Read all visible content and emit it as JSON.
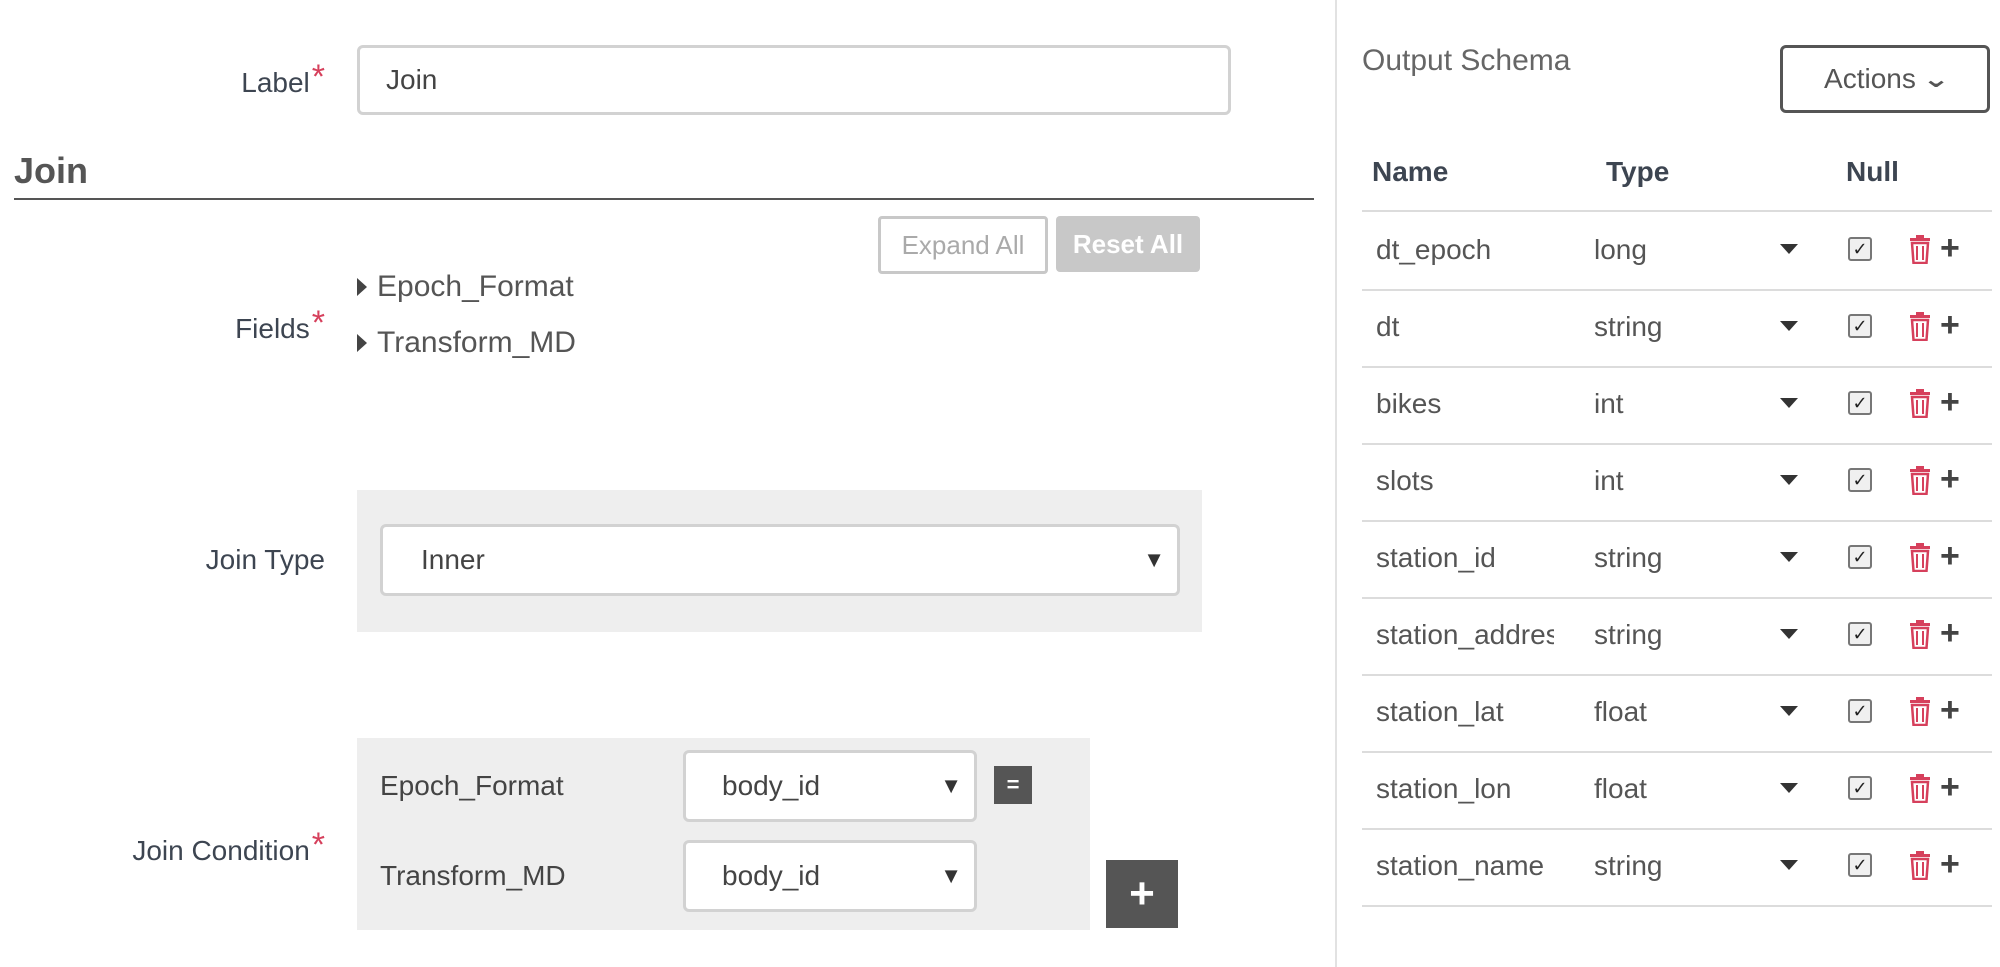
{
  "form": {
    "label_field": {
      "label": "Label",
      "required_mark": "*",
      "value": "Join"
    },
    "section_title": "Join",
    "fields": {
      "label": "Fields",
      "required_mark": "*",
      "expand_all": "Expand All",
      "reset_all": "Reset All",
      "items": [
        "Epoch_Format",
        "Transform_MD"
      ]
    },
    "join_type": {
      "label": "Join Type",
      "value": "Inner"
    },
    "join_condition": {
      "label": "Join Condition",
      "required_mark": "*",
      "rows": [
        {
          "source": "Epoch_Format",
          "field": "body_id"
        },
        {
          "source": "Transform_MD",
          "field": "body_id"
        }
      ],
      "equals_symbol": "=",
      "add_symbol": "+"
    }
  },
  "schema": {
    "title": "Output Schema",
    "actions_label": "Actions",
    "columns": {
      "name": "Name",
      "type": "Type",
      "null": "Null"
    },
    "rows": [
      {
        "name": "dt_epoch",
        "type": "long",
        "nullable": true
      },
      {
        "name": "dt",
        "type": "string",
        "nullable": true
      },
      {
        "name": "bikes",
        "type": "int",
        "nullable": true
      },
      {
        "name": "slots",
        "type": "int",
        "nullable": true
      },
      {
        "name": "station_id",
        "type": "string",
        "nullable": true
      },
      {
        "name": "station_address",
        "type": "string",
        "nullable": true
      },
      {
        "name": "station_lat",
        "type": "float",
        "nullable": true
      },
      {
        "name": "station_lon",
        "type": "float",
        "nullable": true
      },
      {
        "name": "station_name",
        "type": "string",
        "nullable": true
      }
    ]
  },
  "colors": {
    "required": "#d6405c",
    "trash": "#d6405c",
    "dark_button": "#555555",
    "panel": "#eeeeee"
  }
}
